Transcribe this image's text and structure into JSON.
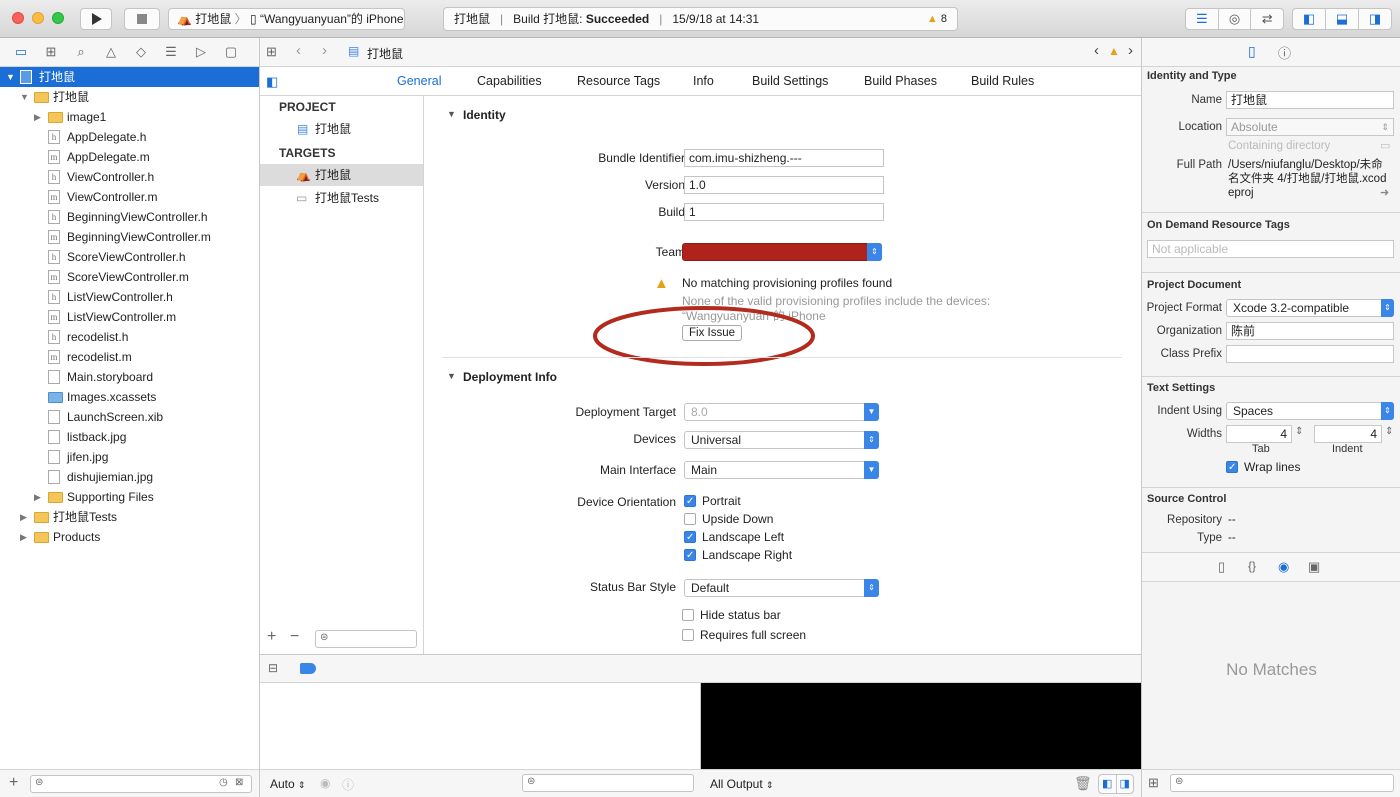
{
  "toolbar": {
    "scheme_target": "打地鼠",
    "scheme_device": "“Wangyuanyuan”的 iPhone",
    "activity_project": "打地鼠",
    "activity_status_prefix": "Build 打地鼠: ",
    "activity_status": "Succeeded",
    "activity_time": "15/9/18 at 14:31",
    "warning_count": "8"
  },
  "navigator": {
    "items": [
      {
        "label": "打地鼠",
        "kind": "project",
        "level": 0,
        "open": true,
        "selected": true
      },
      {
        "label": "打地鼠",
        "kind": "folder",
        "level": 1,
        "open": true
      },
      {
        "label": "image1",
        "kind": "folder",
        "level": 2,
        "open": false
      },
      {
        "label": "AppDelegate.h",
        "kind": "h",
        "level": 2
      },
      {
        "label": "AppDelegate.m",
        "kind": "m",
        "level": 2
      },
      {
        "label": "ViewController.h",
        "kind": "h",
        "level": 2
      },
      {
        "label": "ViewController.m",
        "kind": "m",
        "level": 2
      },
      {
        "label": "BeginningViewController.h",
        "kind": "h",
        "level": 2
      },
      {
        "label": "BeginningViewController.m",
        "kind": "m",
        "level": 2
      },
      {
        "label": "ScoreViewController.h",
        "kind": "h",
        "level": 2
      },
      {
        "label": "ScoreViewController.m",
        "kind": "m",
        "level": 2
      },
      {
        "label": "ListViewController.h",
        "kind": "h",
        "level": 2
      },
      {
        "label": "ListViewController.m",
        "kind": "m",
        "level": 2
      },
      {
        "label": "recodelist.h",
        "kind": "h",
        "level": 2
      },
      {
        "label": "recodelist.m",
        "kind": "m",
        "level": 2
      },
      {
        "label": "Main.storyboard",
        "kind": "file",
        "level": 2
      },
      {
        "label": "Images.xcassets",
        "kind": "assets",
        "level": 2
      },
      {
        "label": "LaunchScreen.xib",
        "kind": "file",
        "level": 2
      },
      {
        "label": "listback.jpg",
        "kind": "file",
        "level": 2
      },
      {
        "label": "jifen.jpg",
        "kind": "file",
        "level": 2
      },
      {
        "label": "dishujiemian.jpg",
        "kind": "file",
        "level": 2
      },
      {
        "label": "Supporting Files",
        "kind": "folder",
        "level": 2,
        "open": false
      },
      {
        "label": "打地鼠Tests",
        "kind": "folder",
        "level": 1,
        "open": false
      },
      {
        "label": "Products",
        "kind": "folder",
        "level": 1,
        "open": false
      }
    ]
  },
  "editor": {
    "jump_title": "打地鼠",
    "tabs": [
      "General",
      "Capabilities",
      "Resource Tags",
      "Info",
      "Build Settings",
      "Build Phases",
      "Build Rules"
    ],
    "project_header": "PROJECT",
    "project_item": "打地鼠",
    "targets_header": "TARGETS",
    "target_app": "打地鼠",
    "target_tests": "打地鼠Tests"
  },
  "identity": {
    "title": "Identity",
    "bundle_label": "Bundle Identifier",
    "bundle_value": "com.imu-shizheng.---",
    "version_label": "Version",
    "version_value": "1.0",
    "build_label": "Build",
    "build_value": "1",
    "team_label": "Team",
    "warning_title": "No matching provisioning profiles found",
    "warning_detail_1": "None of the valid provisioning profiles include the devices:",
    "warning_detail_2": "“Wangyuanyuan”的 iPhone",
    "fix_label": "Fix Issue"
  },
  "deployment": {
    "title": "Deployment Info",
    "target_label": "Deployment Target",
    "target_value": "8.0",
    "devices_label": "Devices",
    "devices_value": "Universal",
    "interface_label": "Main Interface",
    "interface_value": "Main",
    "orientation_label": "Device Orientation",
    "orientations": [
      {
        "label": "Portrait",
        "checked": true
      },
      {
        "label": "Upside Down",
        "checked": false
      },
      {
        "label": "Landscape Left",
        "checked": true
      },
      {
        "label": "Landscape Right",
        "checked": true
      }
    ],
    "statusbar_label": "Status Bar Style",
    "statusbar_value": "Default",
    "hide_status": "Hide status bar",
    "full_screen": "Requires full screen"
  },
  "debug": {
    "auto_label": "Auto",
    "output_label": "All Output"
  },
  "inspector": {
    "identity_title": "Identity and Type",
    "name_label": "Name",
    "name_value": "打地鼠",
    "location_label": "Location",
    "location_value": "Absolute",
    "containing_directory": "Containing directory",
    "fullpath_label": "Full Path",
    "fullpath_value": "/Users/niufanglu/Desktop/未命名文件夹 4/打地鼠/打地鼠.xcodeproj",
    "ondemand_title": "On Demand Resource Tags",
    "ondemand_placeholder": "Not applicable",
    "project_doc_title": "Project Document",
    "format_label": "Project Format",
    "format_value": "Xcode 3.2-compatible",
    "org_label": "Organization",
    "org_value": "陈前",
    "prefix_label": "Class Prefix",
    "text_settings_title": "Text Settings",
    "indent_label": "Indent Using",
    "indent_value": "Spaces",
    "widths_label": "Widths",
    "tab_value": "4",
    "indent_value_num": "4",
    "tab_caption": "Tab",
    "indent_caption": "Indent",
    "wrap_label": "Wrap lines",
    "source_title": "Source Control",
    "repo_label": "Repository",
    "repo_value": "--",
    "type_label": "Type",
    "type_value": "--",
    "no_matches": "No Matches"
  }
}
